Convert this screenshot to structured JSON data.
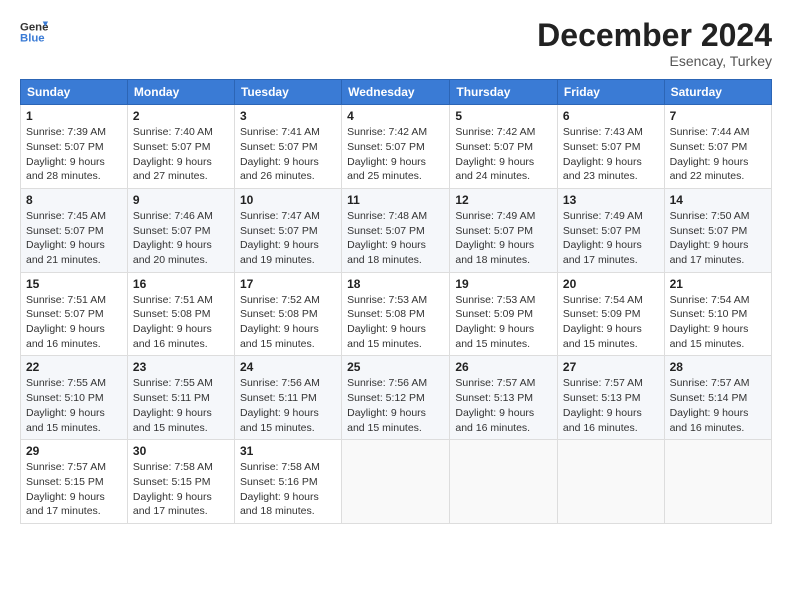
{
  "header": {
    "logo_general": "General",
    "logo_blue": "Blue",
    "month_title": "December 2024",
    "location": "Esencay, Turkey"
  },
  "days_of_week": [
    "Sunday",
    "Monday",
    "Tuesday",
    "Wednesday",
    "Thursday",
    "Friday",
    "Saturday"
  ],
  "weeks": [
    [
      {
        "day": "1",
        "sunrise": "7:39 AM",
        "sunset": "5:07 PM",
        "daylight": "9 hours and 28 minutes."
      },
      {
        "day": "2",
        "sunrise": "7:40 AM",
        "sunset": "5:07 PM",
        "daylight": "9 hours and 27 minutes."
      },
      {
        "day": "3",
        "sunrise": "7:41 AM",
        "sunset": "5:07 PM",
        "daylight": "9 hours and 26 minutes."
      },
      {
        "day": "4",
        "sunrise": "7:42 AM",
        "sunset": "5:07 PM",
        "daylight": "9 hours and 25 minutes."
      },
      {
        "day": "5",
        "sunrise": "7:42 AM",
        "sunset": "5:07 PM",
        "daylight": "9 hours and 24 minutes."
      },
      {
        "day": "6",
        "sunrise": "7:43 AM",
        "sunset": "5:07 PM",
        "daylight": "9 hours and 23 minutes."
      },
      {
        "day": "7",
        "sunrise": "7:44 AM",
        "sunset": "5:07 PM",
        "daylight": "9 hours and 22 minutes."
      }
    ],
    [
      {
        "day": "8",
        "sunrise": "7:45 AM",
        "sunset": "5:07 PM",
        "daylight": "9 hours and 21 minutes."
      },
      {
        "day": "9",
        "sunrise": "7:46 AM",
        "sunset": "5:07 PM",
        "daylight": "9 hours and 20 minutes."
      },
      {
        "day": "10",
        "sunrise": "7:47 AM",
        "sunset": "5:07 PM",
        "daylight": "9 hours and 19 minutes."
      },
      {
        "day": "11",
        "sunrise": "7:48 AM",
        "sunset": "5:07 PM",
        "daylight": "9 hours and 18 minutes."
      },
      {
        "day": "12",
        "sunrise": "7:49 AM",
        "sunset": "5:07 PM",
        "daylight": "9 hours and 18 minutes."
      },
      {
        "day": "13",
        "sunrise": "7:49 AM",
        "sunset": "5:07 PM",
        "daylight": "9 hours and 17 minutes."
      },
      {
        "day": "14",
        "sunrise": "7:50 AM",
        "sunset": "5:07 PM",
        "daylight": "9 hours and 17 minutes."
      }
    ],
    [
      {
        "day": "15",
        "sunrise": "7:51 AM",
        "sunset": "5:07 PM",
        "daylight": "9 hours and 16 minutes."
      },
      {
        "day": "16",
        "sunrise": "7:51 AM",
        "sunset": "5:08 PM",
        "daylight": "9 hours and 16 minutes."
      },
      {
        "day": "17",
        "sunrise": "7:52 AM",
        "sunset": "5:08 PM",
        "daylight": "9 hours and 15 minutes."
      },
      {
        "day": "18",
        "sunrise": "7:53 AM",
        "sunset": "5:08 PM",
        "daylight": "9 hours and 15 minutes."
      },
      {
        "day": "19",
        "sunrise": "7:53 AM",
        "sunset": "5:09 PM",
        "daylight": "9 hours and 15 minutes."
      },
      {
        "day": "20",
        "sunrise": "7:54 AM",
        "sunset": "5:09 PM",
        "daylight": "9 hours and 15 minutes."
      },
      {
        "day": "21",
        "sunrise": "7:54 AM",
        "sunset": "5:10 PM",
        "daylight": "9 hours and 15 minutes."
      }
    ],
    [
      {
        "day": "22",
        "sunrise": "7:55 AM",
        "sunset": "5:10 PM",
        "daylight": "9 hours and 15 minutes."
      },
      {
        "day": "23",
        "sunrise": "7:55 AM",
        "sunset": "5:11 PM",
        "daylight": "9 hours and 15 minutes."
      },
      {
        "day": "24",
        "sunrise": "7:56 AM",
        "sunset": "5:11 PM",
        "daylight": "9 hours and 15 minutes."
      },
      {
        "day": "25",
        "sunrise": "7:56 AM",
        "sunset": "5:12 PM",
        "daylight": "9 hours and 15 minutes."
      },
      {
        "day": "26",
        "sunrise": "7:57 AM",
        "sunset": "5:13 PM",
        "daylight": "9 hours and 16 minutes."
      },
      {
        "day": "27",
        "sunrise": "7:57 AM",
        "sunset": "5:13 PM",
        "daylight": "9 hours and 16 minutes."
      },
      {
        "day": "28",
        "sunrise": "7:57 AM",
        "sunset": "5:14 PM",
        "daylight": "9 hours and 16 minutes."
      }
    ],
    [
      {
        "day": "29",
        "sunrise": "7:57 AM",
        "sunset": "5:15 PM",
        "daylight": "9 hours and 17 minutes."
      },
      {
        "day": "30",
        "sunrise": "7:58 AM",
        "sunset": "5:15 PM",
        "daylight": "9 hours and 17 minutes."
      },
      {
        "day": "31",
        "sunrise": "7:58 AM",
        "sunset": "5:16 PM",
        "daylight": "9 hours and 18 minutes."
      },
      null,
      null,
      null,
      null
    ]
  ]
}
